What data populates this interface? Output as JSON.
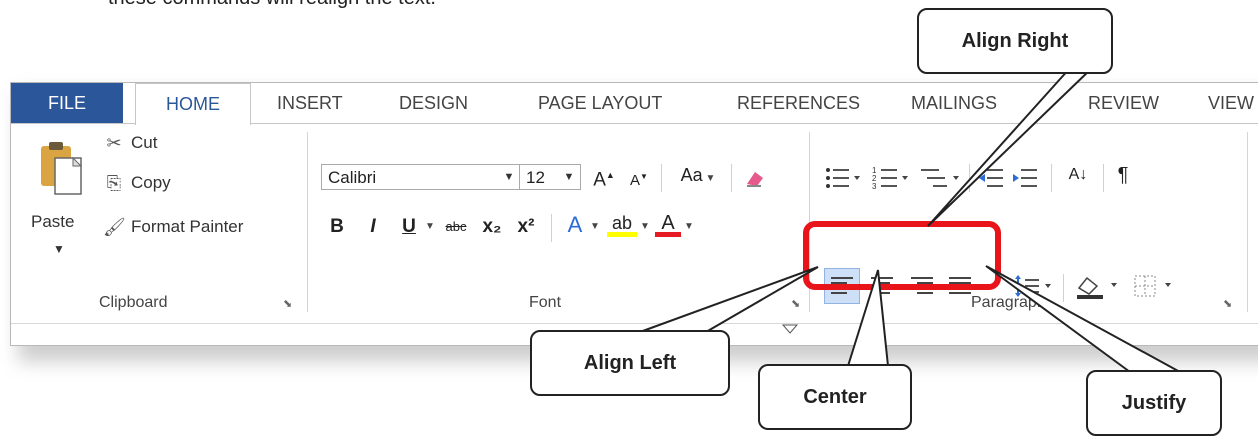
{
  "intro_text": "these commands will realign the text.",
  "tabs": {
    "file": "FILE",
    "home": "HOME",
    "insert": "INSERT",
    "design": "DESIGN",
    "page_layout": "PAGE LAYOUT",
    "references": "REFERENCES",
    "mailings": "MAILINGS",
    "review": "REVIEW",
    "view": "VIEW"
  },
  "clipboard": {
    "paste": "Paste",
    "cut": "Cut",
    "copy": "Copy",
    "format_painter": "Format Painter",
    "label": "Clipboard"
  },
  "font": {
    "name": "Calibri",
    "size": "12",
    "change_case": "Aa",
    "bold": "B",
    "italic": "I",
    "underline": "U",
    "strike": "abc",
    "subscript": "x₂",
    "superscript": "x²",
    "label": "Font"
  },
  "paragraph": {
    "label": "Paragraph",
    "sort_icon": "A↓",
    "pilcrow": "¶"
  },
  "callouts": {
    "align_right": "Align Right",
    "align_left": "Align Left",
    "center": "Center",
    "justify": "Justify"
  },
  "colors": {
    "file_tab": "#2b579a",
    "highlight_box": "#e8141a",
    "text_highlight": "#ffff00",
    "font_color": "#e51c23"
  }
}
